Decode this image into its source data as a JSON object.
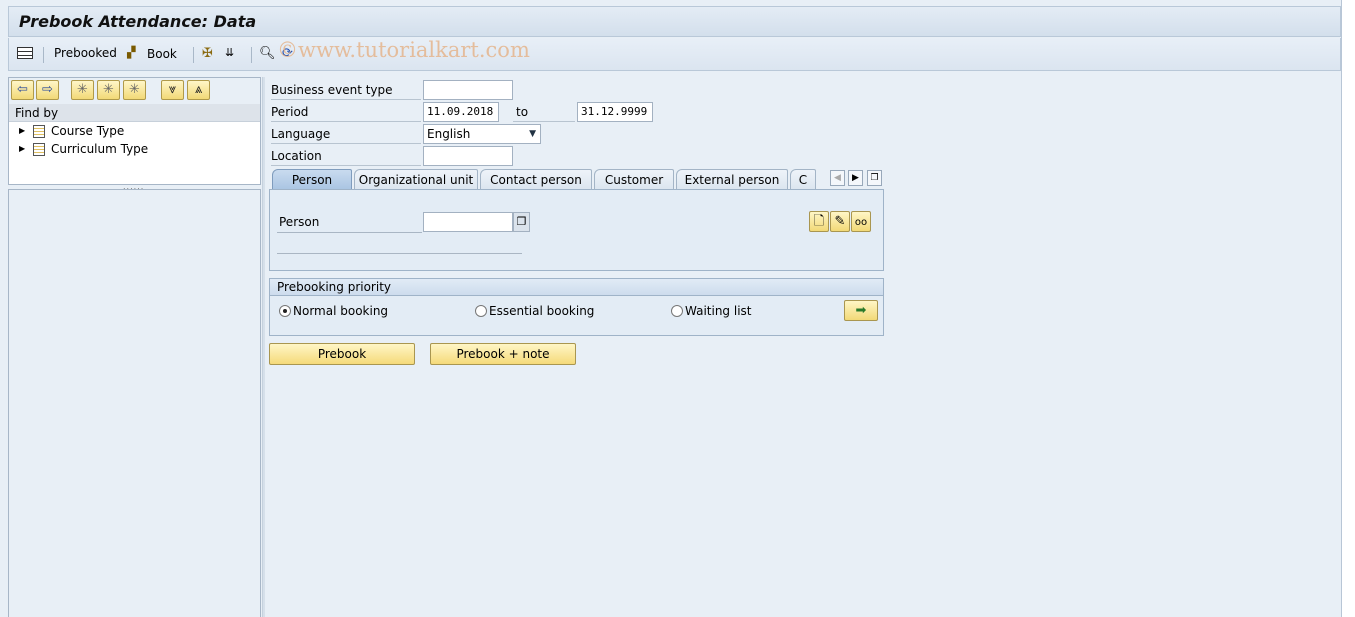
{
  "window": {
    "title": "Prebook Attendance: Data"
  },
  "toolbar": {
    "prebooked_label": "Prebooked",
    "book_label": "Book",
    "watermark": "©www.tutorialkart.com"
  },
  "left": {
    "find_by": "Find by",
    "tree": [
      {
        "label": "Course Type"
      },
      {
        "label": "Curriculum Type"
      }
    ]
  },
  "form": {
    "business_event_type": {
      "label": "Business event type",
      "value": ""
    },
    "period": {
      "label": "Period",
      "from": "11.09.2018",
      "to_label": "to",
      "to": "31.12.9999"
    },
    "language": {
      "label": "Language",
      "value": "English"
    },
    "location": {
      "label": "Location",
      "value": ""
    }
  },
  "tabs": [
    {
      "label": "Person",
      "active": true
    },
    {
      "label": "Organizational unit"
    },
    {
      "label": "Contact person"
    },
    {
      "label": "Customer"
    },
    {
      "label": "External person"
    },
    {
      "label": "C"
    }
  ],
  "person": {
    "label": "Person",
    "value": ""
  },
  "priority": {
    "title": "Prebooking priority",
    "options": [
      {
        "label": "Normal booking",
        "selected": true
      },
      {
        "label": "Essential booking",
        "selected": false
      },
      {
        "label": "Waiting list",
        "selected": false
      }
    ]
  },
  "buttons": {
    "prebook": "Prebook",
    "prebook_note": "Prebook + note"
  }
}
